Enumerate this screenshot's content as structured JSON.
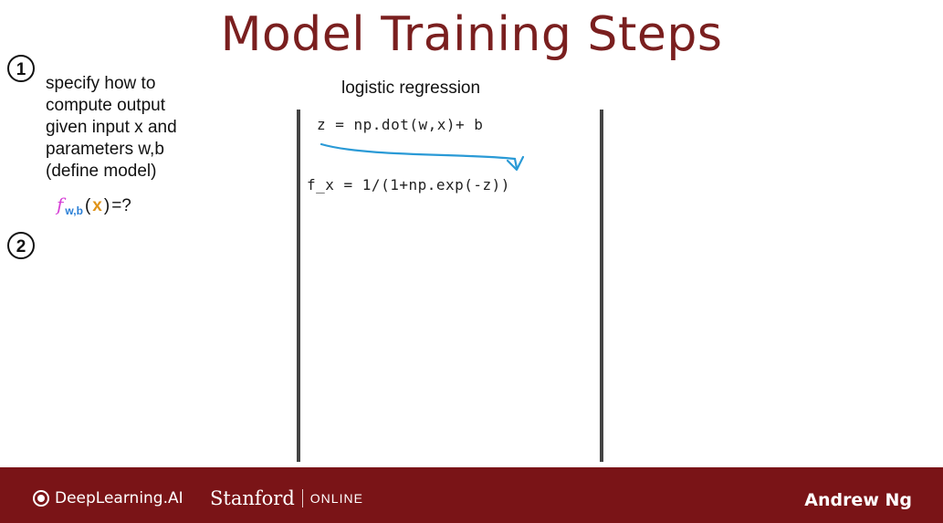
{
  "slide": {
    "title": "Model Training Steps",
    "steps": [
      {
        "number": "1",
        "lines": [
          "specify how to",
          "compute output",
          "given input x and",
          "parameters w,b",
          "(define model)"
        ]
      },
      {
        "number": "2"
      }
    ],
    "formula": {
      "f": "f",
      "subscript": "w,b",
      "arg": "x",
      "rest": "=?"
    },
    "column_header": "logistic regression",
    "code_lines": [
      "z = np.dot(w,x)+ b",
      "f_x = 1/(1+np.exp(-z))"
    ]
  },
  "footer": {
    "brand_left": "DeepLearning.AI",
    "brand_stanford": "Stanford",
    "brand_online": "ONLINE",
    "presenter": "Andrew Ng"
  },
  "colors": {
    "title": "#7a1f1f",
    "footer_bg": "#7a1417",
    "arrow": "#2a9ad6",
    "f_magenta": "#d63fd6",
    "x_orange": "#e0941a"
  }
}
